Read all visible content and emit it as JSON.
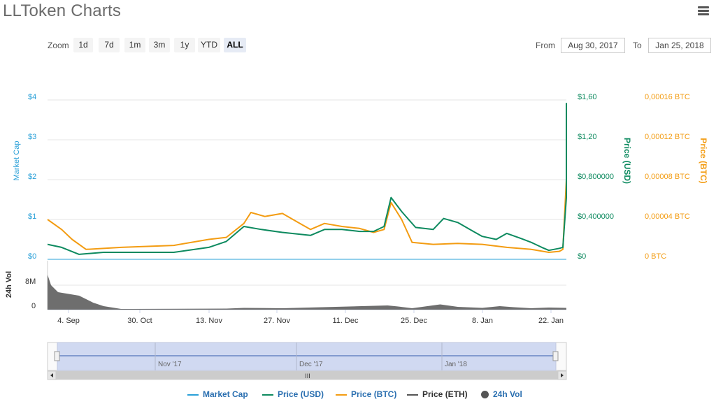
{
  "header": {
    "title": "LLToken Charts",
    "menu_icon": "hamburger-menu-icon"
  },
  "zoom": {
    "label": "Zoom",
    "buttons": [
      "1d",
      "7d",
      "1m",
      "3m",
      "1y",
      "YTD",
      "ALL"
    ],
    "active": "ALL"
  },
  "range": {
    "from_label": "From",
    "from_value": "Aug 30, 2017",
    "to_label": "To",
    "to_value": "Jan 25, 2018"
  },
  "colors": {
    "market_cap": "#2aa0d8",
    "price_usd": "#0d8a5f",
    "price_btc": "#f39c12",
    "price_eth": "#555555",
    "volume": "#555555"
  },
  "chart_data": {
    "type": "line",
    "x_ticks": [
      "4. Sep",
      "30. Oct",
      "13. Nov",
      "27. Nov",
      "11. Dec",
      "25. Dec",
      "8. Jan",
      "22. Jan"
    ],
    "axes": {
      "market_cap": {
        "label": "Market Cap",
        "ticks": [
          "$0",
          "$1",
          "$2",
          "$3",
          "$4"
        ],
        "range": [
          0,
          4
        ]
      },
      "price_usd": {
        "label": "Price (USD)",
        "ticks": [
          "$0",
          "$0,400000",
          "$0,800000",
          "$1,20",
          "$1,60"
        ],
        "range": [
          0,
          1.6
        ]
      },
      "price_btc": {
        "label": "Price (BTC)",
        "ticks": [
          "0 BTC",
          "0,00004 BTC",
          "0,00008 BTC",
          "0,00012 BTC",
          "0,00016 BTC"
        ],
        "range": [
          0,
          0.00016
        ]
      },
      "volume": {
        "label": "24h Vol",
        "ticks": [
          "0",
          "8M"
        ],
        "range": [
          0,
          12
        ]
      }
    },
    "x_range": [
      "2017-08-30",
      "2018-01-25"
    ],
    "series": [
      {
        "name": "Market Cap",
        "points": [
          [
            "2017-08-30",
            0
          ],
          [
            "2018-01-25",
            0
          ]
        ]
      },
      {
        "name": "Price (USD)",
        "points": [
          [
            "2017-08-30",
            0.15
          ],
          [
            "2017-09-03",
            0.12
          ],
          [
            "2017-09-08",
            0.05
          ],
          [
            "2017-09-15",
            0.07
          ],
          [
            "2017-09-25",
            0.07
          ],
          [
            "2017-10-05",
            0.07
          ],
          [
            "2017-10-15",
            0.12
          ],
          [
            "2017-10-20",
            0.18
          ],
          [
            "2017-10-25",
            0.33
          ],
          [
            "2017-10-30",
            0.3
          ],
          [
            "2017-11-05",
            0.27
          ],
          [
            "2017-11-13",
            0.24
          ],
          [
            "2017-11-17",
            0.3
          ],
          [
            "2017-11-22",
            0.3
          ],
          [
            "2017-11-27",
            0.28
          ],
          [
            "2017-12-01",
            0.28
          ],
          [
            "2017-12-04",
            0.33
          ],
          [
            "2017-12-06",
            0.62
          ],
          [
            "2017-12-09",
            0.48
          ],
          [
            "2017-12-13",
            0.32
          ],
          [
            "2017-12-18",
            0.3
          ],
          [
            "2017-12-21",
            0.41
          ],
          [
            "2017-12-25",
            0.37
          ],
          [
            "2017-12-29",
            0.29
          ],
          [
            "2018-01-01",
            0.23
          ],
          [
            "2018-01-05",
            0.2
          ],
          [
            "2018-01-08",
            0.26
          ],
          [
            "2018-01-12",
            0.21
          ],
          [
            "2018-01-15",
            0.17
          ],
          [
            "2018-01-18",
            0.12
          ],
          [
            "2018-01-20",
            0.09
          ],
          [
            "2018-01-23",
            0.11
          ],
          [
            "2018-01-24",
            0.12
          ],
          [
            "2018-01-25",
            0.62
          ],
          [
            "2018-01-25",
            1.57
          ]
        ]
      },
      {
        "name": "Price (BTC)",
        "points": [
          [
            "2017-08-30",
            4e-05
          ],
          [
            "2017-09-03",
            3e-05
          ],
          [
            "2017-09-06",
            2e-05
          ],
          [
            "2017-09-10",
            1e-05
          ],
          [
            "2017-09-20",
            1.2e-05
          ],
          [
            "2017-10-05",
            1.4e-05
          ],
          [
            "2017-10-15",
            2e-05
          ],
          [
            "2017-10-20",
            2.2e-05
          ],
          [
            "2017-10-25",
            3.6e-05
          ],
          [
            "2017-10-27",
            4.7e-05
          ],
          [
            "2017-10-31",
            4.3e-05
          ],
          [
            "2017-11-05",
            4.6e-05
          ],
          [
            "2017-11-10",
            3.6e-05
          ],
          [
            "2017-11-13",
            3e-05
          ],
          [
            "2017-11-17",
            3.6e-05
          ],
          [
            "2017-11-22",
            3.3e-05
          ],
          [
            "2017-11-27",
            3.1e-05
          ],
          [
            "2017-12-01",
            2.7e-05
          ],
          [
            "2017-12-04",
            3e-05
          ],
          [
            "2017-12-06",
            5.7e-05
          ],
          [
            "2017-12-09",
            4e-05
          ],
          [
            "2017-12-12",
            1.7e-05
          ],
          [
            "2017-12-18",
            1.5e-05
          ],
          [
            "2017-12-25",
            1.6e-05
          ],
          [
            "2018-01-01",
            1.5e-05
          ],
          [
            "2018-01-08",
            1.2e-05
          ],
          [
            "2018-01-15",
            1e-05
          ],
          [
            "2018-01-20",
            7e-06
          ],
          [
            "2018-01-23",
            8e-06
          ],
          [
            "2018-01-24",
            1e-05
          ],
          [
            "2018-01-25",
            8e-05
          ],
          [
            "2018-01-25",
            0.000137
          ]
        ]
      }
    ],
    "volume": [
      [
        "2017-08-30",
        10
      ],
      [
        "2017-08-31",
        7
      ],
      [
        "2017-09-02",
        5
      ],
      [
        "2017-09-05",
        4.5
      ],
      [
        "2017-09-08",
        4
      ],
      [
        "2017-09-12",
        2
      ],
      [
        "2017-09-15",
        1
      ],
      [
        "2017-09-20",
        0.2
      ],
      [
        "2017-10-20",
        0.3
      ],
      [
        "2017-10-25",
        0.5
      ],
      [
        "2017-11-05",
        0.4
      ],
      [
        "2017-12-05",
        1.2
      ],
      [
        "2017-12-08",
        0.9
      ],
      [
        "2017-12-12",
        0.4
      ],
      [
        "2017-12-20",
        1.5
      ],
      [
        "2017-12-25",
        0.8
      ],
      [
        "2018-01-01",
        0.5
      ],
      [
        "2018-01-06",
        1.0
      ],
      [
        "2018-01-10",
        0.7
      ],
      [
        "2018-01-15",
        0.4
      ],
      [
        "2018-01-20",
        0.6
      ],
      [
        "2018-01-25",
        0.5
      ]
    ],
    "legend": [
      "Market Cap",
      "Price (USD)",
      "Price (BTC)",
      "Price (ETH)",
      "24h Vol"
    ],
    "legend_position": "bottom",
    "grid": true
  },
  "navigator": {
    "labels": [
      "Nov '17",
      "Dec '17",
      "Jan '18"
    ],
    "scrollbar_grip": "III"
  }
}
